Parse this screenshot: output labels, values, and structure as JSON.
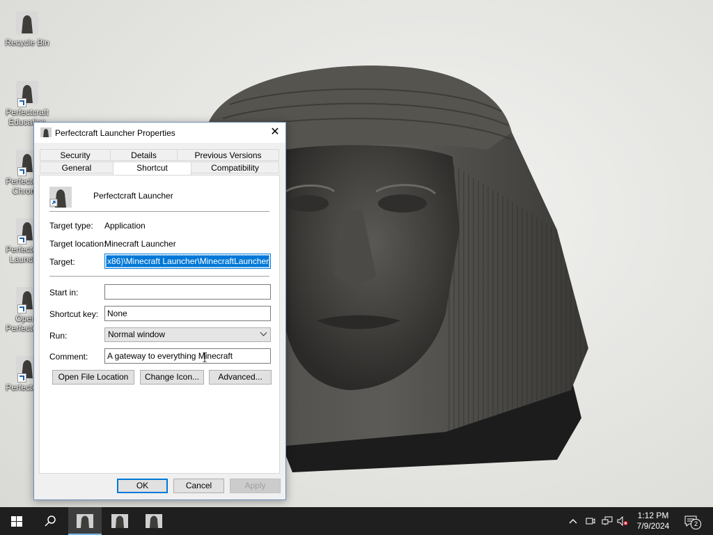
{
  "desktop": {
    "icons": [
      {
        "label": "Recycle Bin",
        "shortcut": false
      },
      {
        "label": "Perfectcraft Education",
        "shortcut": true
      },
      {
        "label": "Perfectcraft Chrome",
        "shortcut": true
      },
      {
        "label": "Perfectcraft Launcher",
        "shortcut": true
      },
      {
        "label": "Opera Perfectcraft Browser",
        "shortcut": true
      },
      {
        "label": "Perfectcraft",
        "shortcut": true
      }
    ]
  },
  "dialog": {
    "title": "Perfectcraft Launcher Properties",
    "close_glyph": "✕",
    "tabs_row1": [
      "Security",
      "Details",
      "Previous Versions"
    ],
    "tabs_row2": [
      "General",
      "Shortcut",
      "Compatibility"
    ],
    "active_tab": "Shortcut",
    "shortcut_name": "Perfectcraft Launcher",
    "target_type_label": "Target type:",
    "target_type_value": "Application",
    "target_location_label": "Target location:",
    "target_location_value": "Minecraft Launcher",
    "target_label": "Target:",
    "target_value": "x86)\\Minecraft Launcher\\MinecraftLauncher.exe\"",
    "start_in_label": "Start in:",
    "start_in_value": "",
    "shortcut_key_label": "Shortcut key:",
    "shortcut_key_value": "None",
    "run_label": "Run:",
    "run_value": "Normal window",
    "comment_label": "Comment:",
    "comment_value": "A gateway to everything Minecraft",
    "open_file_location": "Open File Location",
    "change_icon": "Change Icon...",
    "advanced": "Advanced...",
    "ok": "OK",
    "cancel": "Cancel",
    "apply": "Apply"
  },
  "taskbar": {
    "time": "1:12 PM",
    "date": "7/9/2024",
    "notification_count": "2",
    "accent": "#0078d7"
  }
}
